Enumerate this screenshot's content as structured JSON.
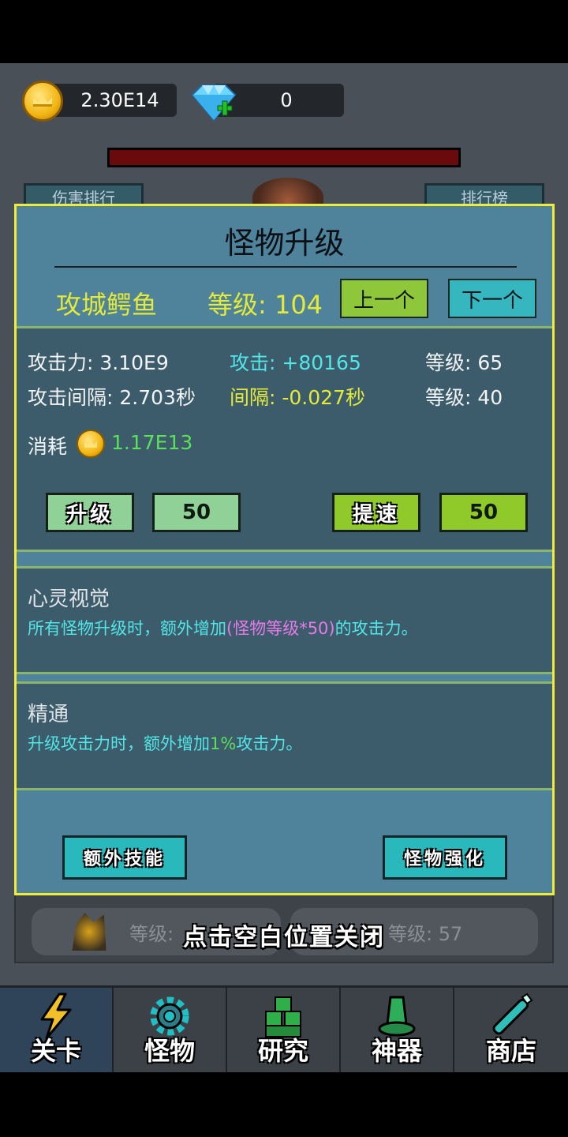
{
  "currency": {
    "coins": "2.30E14",
    "gems": "0"
  },
  "background": {
    "left_button": "伤害排行",
    "right_button": "排行榜",
    "list_left_level": "等级:",
    "list_right_level": "等级: 57"
  },
  "panel": {
    "title": "怪物升级",
    "monster_name": "攻城鳄鱼",
    "level_label": "等级: 104",
    "prev_button": "上一个",
    "next_button": "下一个",
    "stats": {
      "attack": "攻击力: 3.10E9",
      "attack_bonus": "攻击: +80165",
      "attack_level": "等级: 65",
      "interval": "攻击间隔: 2.703秒",
      "interval_bonus": "间隔: -0.027秒",
      "interval_level": "等级: 40",
      "cost_label": "消耗",
      "cost_value": "1.17E13"
    },
    "upgrade_button": "升级",
    "upgrade_amount": "50",
    "speed_button": "提速",
    "speed_amount": "50",
    "skills": [
      {
        "name": "心灵视觉",
        "desc_pre": "所有怪物升级时，额外增加",
        "desc_highlight": "(怪物等级*50)",
        "desc_post": "的攻击力。"
      },
      {
        "name": "精通",
        "desc_pre": "升级攻击力时，额外增加",
        "desc_highlight": "1%",
        "desc_post": "攻击力。"
      }
    ],
    "extra_skill_button": "额外技能",
    "enhance_button": "怪物强化"
  },
  "close_hint": "点击空白位置关闭",
  "nav": [
    {
      "label": "关卡",
      "icon": "lightning-icon"
    },
    {
      "label": "怪物",
      "icon": "gear-icon"
    },
    {
      "label": "研究",
      "icon": "cubes-icon"
    },
    {
      "label": "神器",
      "icon": "bell-icon"
    },
    {
      "label": "商店",
      "icon": "bottle-icon"
    }
  ],
  "colors": {
    "panel_bg": "#4f829b",
    "panel_border": "#eded3a",
    "highlight_yellow": "#e3ea3a",
    "cyan_text": "#52e6e6",
    "green_text": "#5ce05c",
    "pink_text": "#e77ae8"
  }
}
